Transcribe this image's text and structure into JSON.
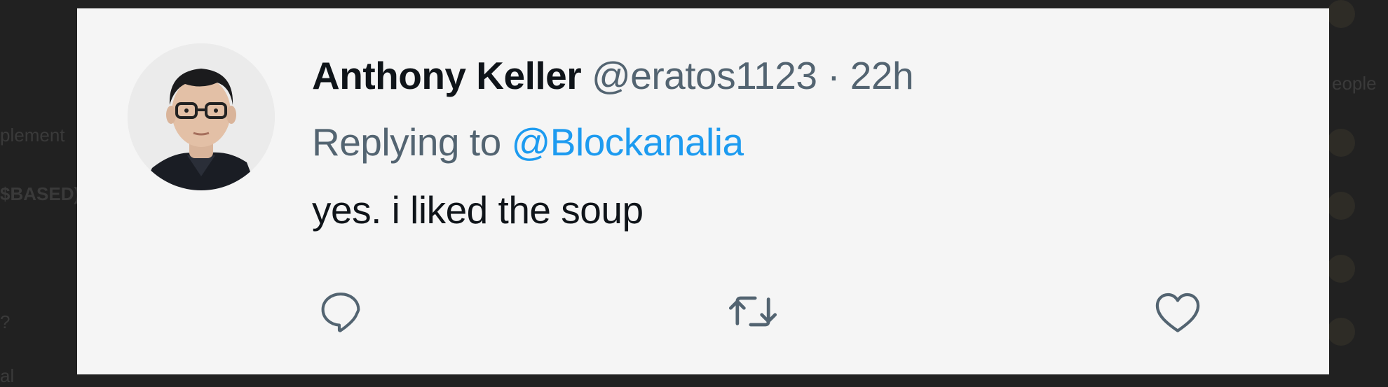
{
  "background": {
    "left_fragments": [
      "plement",
      "$BASED)",
      "?",
      "al"
    ],
    "right_fragments": [
      "eople"
    ],
    "top_fragment": "",
    "bottom_fragment": ""
  },
  "tweet": {
    "author_name": "Anthony Keller",
    "handle": "@eratos1123",
    "separator": "·",
    "time": "22h",
    "replying_prefix": "Replying to",
    "replying_to": "@Blockanalia",
    "text": "yes. i liked the soup",
    "avatar_icon": "user-avatar-photo"
  },
  "actions": {
    "reply_icon": "speech-bubble-icon",
    "retweet_icon": "retweet-icon",
    "like_icon": "heart-icon"
  },
  "colors": {
    "page_background": "#212121",
    "card_background": "#f5f5f5",
    "name": "#0f1419",
    "secondary": "#536471",
    "mention": "#1d9bf0",
    "icon": "#536471"
  }
}
